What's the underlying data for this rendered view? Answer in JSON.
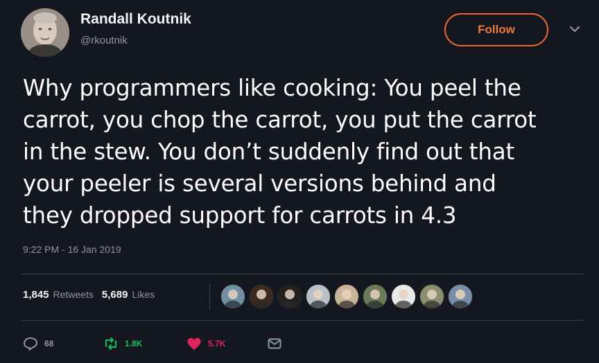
{
  "author": {
    "name": "Randall Koutnik",
    "handle": "@rkoutnik",
    "follow_label": "Follow"
  },
  "tweet": {
    "lines": [
      "Why programmers like cooking:  You peel the",
      "carrot, you chop the carrot, you put the carrot",
      "in the stew.  You don’t suddenly find out that",
      "your peeler is several versions behind and",
      "they dropped support for carrots in 4.3"
    ],
    "timestamp": "9:22 PM - 16 Jan 2019"
  },
  "stats": {
    "retweets_count": "1,845",
    "retweets_label": "Retweets",
    "likes_count": "5,689",
    "likes_label": "Likes"
  },
  "likers": [
    {
      "icon": "avatar-icon",
      "bg": "#6f8fa0"
    },
    {
      "icon": "avatar-icon",
      "bg": "#3a2a20"
    },
    {
      "icon": "avatar-icon",
      "bg": "#202020"
    },
    {
      "icon": "avatar-icon",
      "bg": "#b8c0c8"
    },
    {
      "icon": "avatar-icon",
      "bg": "#c9b49a"
    },
    {
      "icon": "avatar-icon",
      "bg": "#6a7a5a"
    },
    {
      "icon": "avatar-icon",
      "bg": "#e9e9e9"
    },
    {
      "icon": "avatar-icon",
      "bg": "#8a8f70"
    },
    {
      "icon": "avatar-icon",
      "bg": "#7a8ea8"
    }
  ],
  "actions": {
    "reply_count": "68",
    "retweet_count": "1.8K",
    "like_count": "5.7K"
  },
  "colors": {
    "background": "#14171f",
    "accent_follow": "#e8682c",
    "retweet_green": "#17bf63",
    "like_pink": "#e0245e",
    "muted": "#8899a6"
  }
}
